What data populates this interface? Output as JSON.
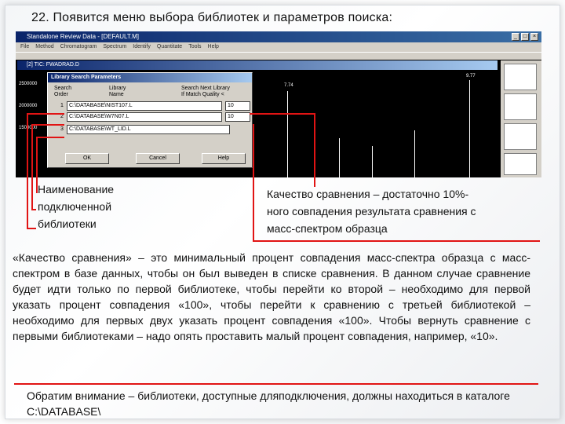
{
  "heading": "22. Появится меню выбора библиотек и параметров поиска:",
  "screenshot": {
    "window_title": "Standalone Review Data - [DEFAULT.M]",
    "menu_items": [
      "File",
      "Method",
      "Chromatogram",
      "Spectrum",
      "Identify",
      "Quantitate",
      "Tools",
      "Help"
    ],
    "document_title": "[2] TIC: FWADRAD.D",
    "y_ticks": [
      "2500000",
      "2000000",
      "1500000"
    ],
    "peak_labels": [
      "7.74",
      "9.77"
    ]
  },
  "dialog": {
    "title": "Library Search Parameters",
    "col_order": "Search\nOrder",
    "col_library": "Library\nName",
    "col_next": "Search Next Library\nIf Match Quality <",
    "rows": [
      {
        "order": "1",
        "library": "C:\\DATABASE\\NIST107.L",
        "quality": "10"
      },
      {
        "order": "2",
        "library": "C:\\DATABASE\\W7N07.L",
        "quality": "10"
      },
      {
        "order": "3",
        "library": "C:\\DATABASE\\WT_LID.L",
        "quality": ""
      }
    ],
    "ok_label": "OK",
    "cancel_label": "Cancel",
    "help_label": "Help"
  },
  "callouts": {
    "library_name": "Наименование\nподключенной\nбиблиотеки",
    "match_quality": "Качество сравнения – достаточно 10%-\nного совпадения результата сравнения с\nмасс-спектром образца"
  },
  "paragraph": "«Качество сравнения» – это минимальный процент совпадения масс-спектра образца с масс-спектром в базе данных, чтобы он был выведен в списке сравнения. В данном случае сравнение будет идти только по первой библиотеке, чтобы перейти ко второй – необходимо для первой указать процент совпадения «100», чтобы перейти к сравнению с третьей библиотекой – необходимо для первых двух указать процент совпадения «100». Чтобы вернуть сравнение с первыми библиотеками – надо опять проставить малый процент совпадения, например, «10».",
  "note": "Обратим внимание – библиотеки, доступные дляподключения, должны находиться в каталоге C:\\DATABASE\\",
  "colors": {
    "annotation": "#e11414",
    "titlebar": "#0a246a",
    "window_bg": "#d4d0c8"
  }
}
